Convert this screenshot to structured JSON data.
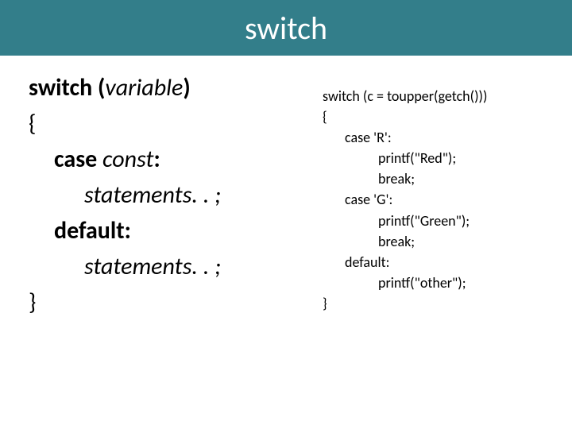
{
  "header": {
    "title": "switch"
  },
  "syntax": {
    "l1_kw": "switch ",
    "l1_open": "(",
    "l1_var": "variable",
    "l1_close": ")",
    "l2": "{",
    "l3_kw": "case ",
    "l3_rest": "const",
    "l3_colon": ":",
    "l4": "statements. . ;",
    "l5_kw": "default",
    "l5_colon": ":",
    "l6": "statements. . ;",
    "l7": "}"
  },
  "example": {
    "l1a": "switch ",
    "l1b": "(c = toupper(getch()))",
    "l2": "{",
    "l3a": "case ",
    "l3b": "'R'",
    "l3c": ":",
    "l4": "printf(\"Red\");",
    "l5": "break;",
    "l6a": "case ",
    "l6b": "'G'",
    "l6c": ":",
    "l7": "printf(\"Green\");",
    "l8": "break;",
    "l9a": "default",
    "l9b": ":",
    "l10": "printf(\"other\");",
    "l11": "}"
  }
}
